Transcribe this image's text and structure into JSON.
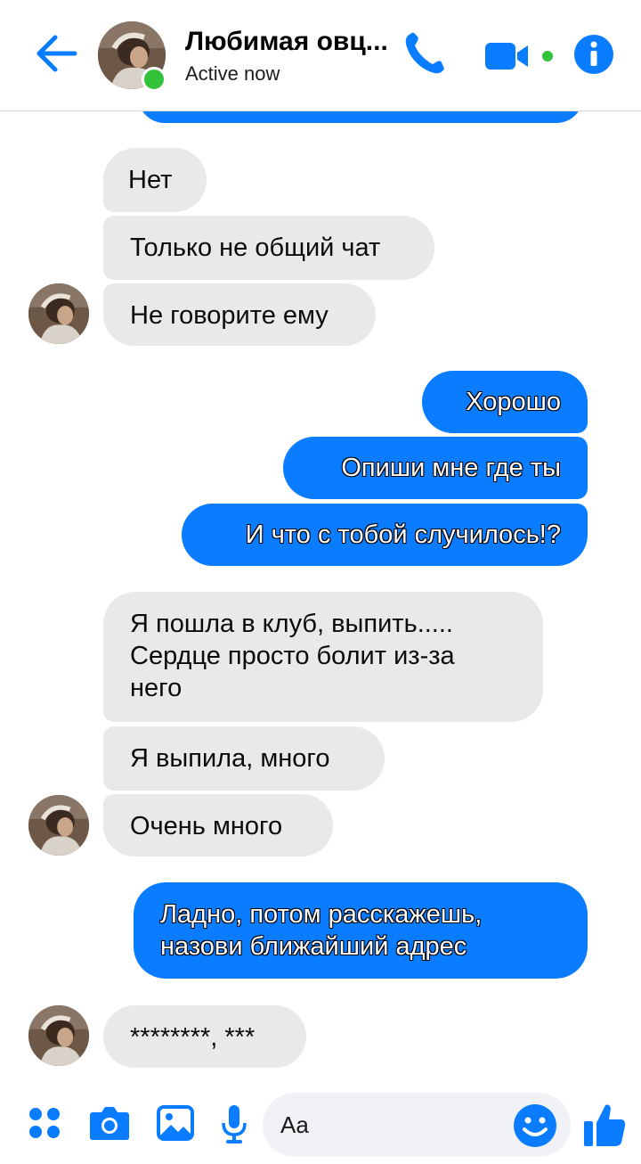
{
  "header": {
    "contact_name": "Любимая овц...",
    "status": "Active now",
    "colors": {
      "accent": "#0a7cff",
      "online": "#31c23a"
    },
    "icons": [
      "back-arrow-icon",
      "phone-icon",
      "video-camera-icon",
      "info-icon"
    ]
  },
  "messages": [
    {
      "from": "contact",
      "text": "Нет"
    },
    {
      "from": "contact",
      "text": "Только не общий чат"
    },
    {
      "from": "contact",
      "text": "Не говорите ему"
    },
    {
      "from": "me",
      "text": "Хорошо"
    },
    {
      "from": "me",
      "text": "Опиши мне где ты"
    },
    {
      "from": "me",
      "text": "И что с тобой случилось!?"
    },
    {
      "from": "contact",
      "text": "Я пошла в клуб, выпить.....\nСердце просто болит из-за\nнего"
    },
    {
      "from": "contact",
      "text": "Я выпила, много"
    },
    {
      "from": "contact",
      "text": "Очень много"
    },
    {
      "from": "me",
      "text": "Ладно, потом расскажешь,\nназови ближайший адрес"
    },
    {
      "from": "contact",
      "text": "********, ***"
    }
  ],
  "composer": {
    "placeholder": "Aa",
    "icons": [
      "apps-icon",
      "camera-icon",
      "image-icon",
      "microphone-icon",
      "emoji-icon",
      "thumbs-up-icon"
    ]
  }
}
